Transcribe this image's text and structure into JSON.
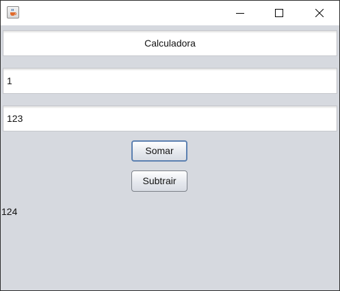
{
  "window": {
    "title": "",
    "icons": {
      "app": "java-cup-icon",
      "minimize": "minimize-icon",
      "maximize": "maximize-icon",
      "close": "close-icon"
    }
  },
  "form": {
    "header_field": "Calculadora",
    "input1": "1",
    "input2": "123",
    "sum_button": "Somar",
    "subtract_button": "Subtrair",
    "result": "124"
  },
  "colors": {
    "background": "#d6d9df",
    "field": "#ffffff",
    "focus_border": "#5a7fb0"
  }
}
